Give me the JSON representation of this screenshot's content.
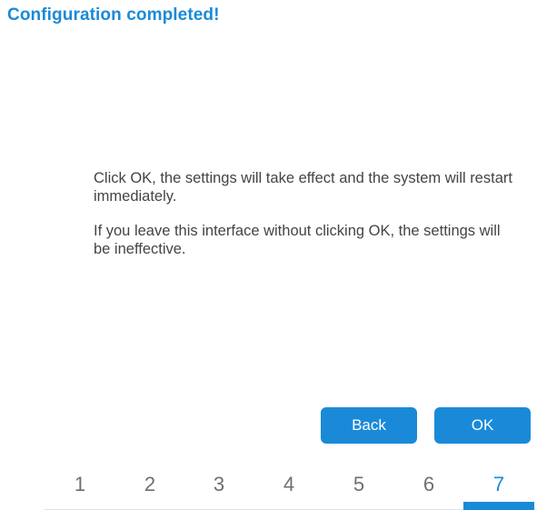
{
  "header": {
    "title": "Configuration completed!"
  },
  "message": {
    "line1": "Click OK, the settings will take effect and the system will restart immediately.",
    "line2": "If you leave this interface without clicking OK, the settings will be ineffective."
  },
  "actions": {
    "back_label": "Back",
    "ok_label": "OK"
  },
  "steps": {
    "items": [
      "1",
      "2",
      "3",
      "4",
      "5",
      "6",
      "7"
    ],
    "active_index": 6
  },
  "colors": {
    "accent": "#1a8ad8",
    "text": "#444444",
    "step_inactive": "#6f6f6f"
  }
}
